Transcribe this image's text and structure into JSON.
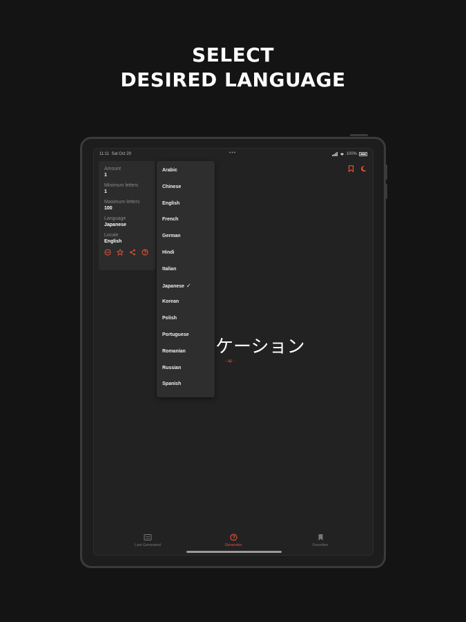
{
  "headline": {
    "line1": "SELECT",
    "line2": "DESIRED LANGUAGE"
  },
  "status_bar": {
    "time": "11:11",
    "date": "Sat Oct 29",
    "battery": "100%"
  },
  "settings": {
    "amount_label": "Amount",
    "amount_value": "1",
    "min_label": "Minimum letters",
    "min_value": "1",
    "max_label": "Maximum letters",
    "max_value": "100",
    "language_label": "Language",
    "language_value": "Japanese",
    "locale_label": "Locale",
    "locale_value": "English"
  },
  "languages": [
    {
      "label": "Arabic"
    },
    {
      "label": "Chinese"
    },
    {
      "label": "English"
    },
    {
      "label": "French"
    },
    {
      "label": "German"
    },
    {
      "label": "Hindi"
    },
    {
      "label": "Italian"
    },
    {
      "label": "Japanese",
      "selected": true
    },
    {
      "label": "Korean"
    },
    {
      "label": "Polish"
    },
    {
      "label": "Portuguese"
    },
    {
      "label": "Romanian"
    },
    {
      "label": "Russian"
    },
    {
      "label": "Spanish"
    }
  ],
  "generated": {
    "word": "ケーション",
    "locale": "- ap -"
  },
  "tabs": [
    {
      "label": "Last Generated",
      "active": false
    },
    {
      "label": "Generator",
      "active": true
    },
    {
      "label": "Favorites",
      "active": false
    }
  ],
  "colors": {
    "accent": "#e5533d",
    "background": "#141414",
    "screen": "#222222"
  },
  "icons": [
    "bookmark-icon",
    "moon-icon",
    "reset-icon",
    "star-icon",
    "share-icon",
    "help-icon",
    "list-icon",
    "generator-icon",
    "favorites-icon"
  ]
}
